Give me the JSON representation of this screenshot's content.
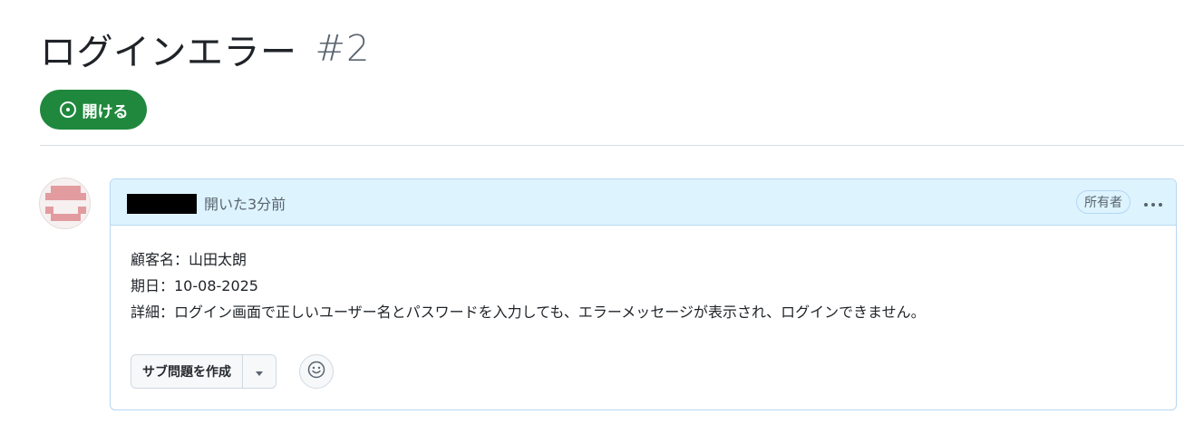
{
  "issue": {
    "title": "ログインエラー",
    "number": "#2",
    "state_label": "開ける"
  },
  "comment": {
    "opened_text": "開いた3分前",
    "owner_badge": "所有者",
    "body_lines": [
      "顧客名：山田太朗",
      "期日：10-08-2025",
      "詳細：ログイン画面で正しいユーザー名とパスワードを入力しても、エラーメッセージが表示され、ログインできません。"
    ]
  },
  "actions": {
    "create_sub_issue_label": "サブ問題を作成"
  },
  "icons": {
    "state": "issue-opened-icon",
    "more": "kebab-horizontal-icon",
    "caret": "triangle-down-icon",
    "emoji": "smiley-icon"
  },
  "colors": {
    "open_state": "#1f883d",
    "header_bg": "#ddf4ff",
    "header_border": "#b6d7f2",
    "muted_text": "#59636e"
  }
}
